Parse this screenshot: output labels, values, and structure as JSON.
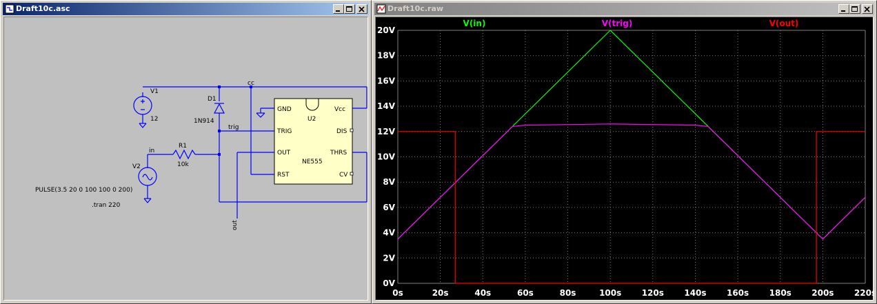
{
  "schematic": {
    "title": "Draft10c.asc",
    "labels": {
      "v1_name": "V1",
      "v1_value": "12",
      "v2_name": "V2",
      "v2_value": "PULSE(3.5 20 0 100 100 0 200)",
      "tran": ".tran 220",
      "d1_name": "D1",
      "d1_model": "1N914",
      "r1_name": "R1",
      "r1_value": "10k",
      "net_in": "in",
      "net_trig": "trig",
      "net_cc": "cc",
      "net_out": "out",
      "u2_name": "U2",
      "u2_model": "NE555",
      "pin_gnd": "GND",
      "pin_vcc": "Vcc",
      "pin_trig": "TRIG",
      "pin_dis": "DIS",
      "pin_out": "OUT",
      "pin_thrs": "THRS",
      "pin_rst": "RST",
      "pin_cv": "CV"
    },
    "colors": {
      "wire": "#0000ff",
      "component": "#0000ff",
      "text": "#000000",
      "ic_fill": "#ffffc8"
    }
  },
  "plot": {
    "title": "Draft10c.raw",
    "colors": {
      "background": "#000000",
      "grid": "#808080",
      "axis_text": "#ffffff"
    }
  },
  "chart_data": {
    "type": "line",
    "xlim": [
      0,
      220
    ],
    "ylim": [
      0,
      20
    ],
    "x_ticks": [
      "0s",
      "20s",
      "40s",
      "60s",
      "80s",
      "100s",
      "120s",
      "140s",
      "160s",
      "180s",
      "200s",
      "220s"
    ],
    "y_ticks": [
      "0V",
      "2V",
      "4V",
      "6V",
      "8V",
      "10V",
      "12V",
      "14V",
      "16V",
      "18V",
      "20V"
    ],
    "grid": true,
    "legend": "top",
    "series": [
      {
        "name": "V(in)",
        "color": "#00ff00",
        "x": [
          0,
          100,
          200,
          220
        ],
        "y": [
          3.5,
          20,
          3.5,
          6.8
        ]
      },
      {
        "name": "V(trig)",
        "color": "#ff00ff",
        "x": [
          0,
          54,
          60,
          100,
          140,
          146,
          200,
          220
        ],
        "y": [
          3.5,
          12.4,
          12.5,
          12.6,
          12.5,
          12.4,
          3.5,
          6.8
        ]
      },
      {
        "name": "V(out)",
        "color": "#ff0000",
        "x": [
          0,
          27,
          27,
          197,
          197,
          220
        ],
        "y": [
          12,
          12,
          0,
          0,
          12,
          12
        ]
      }
    ]
  }
}
